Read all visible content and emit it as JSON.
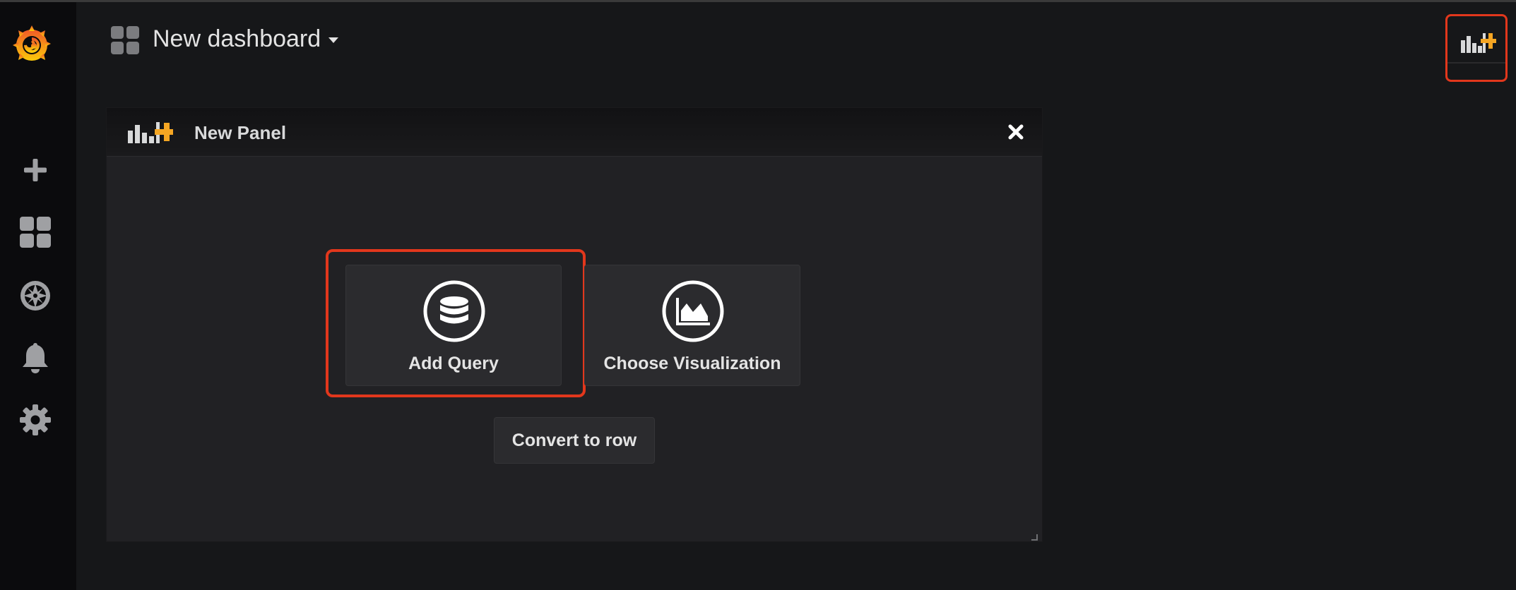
{
  "header": {
    "dashboard_title": "New dashboard"
  },
  "sidebar": {
    "items": [
      {
        "name": "create",
        "icon": "plus-icon"
      },
      {
        "name": "dashboards",
        "icon": "grid-icon"
      },
      {
        "name": "explore",
        "icon": "compass-icon"
      },
      {
        "name": "alerting",
        "icon": "bell-icon"
      },
      {
        "name": "configuration",
        "icon": "gear-icon"
      }
    ]
  },
  "panel": {
    "title": "New Panel",
    "actions": {
      "add_query": "Add Query",
      "choose_visualization": "Choose Visualization",
      "convert_to_row": "Convert to row"
    }
  },
  "colors": {
    "background": "#161719",
    "sidebar": "#0b0b0d",
    "panel": "#212124",
    "highlight": "#e2371c",
    "accent_orange": "#f5a623",
    "logo_orange": "#f05a28",
    "logo_yellow": "#fbca0a"
  }
}
